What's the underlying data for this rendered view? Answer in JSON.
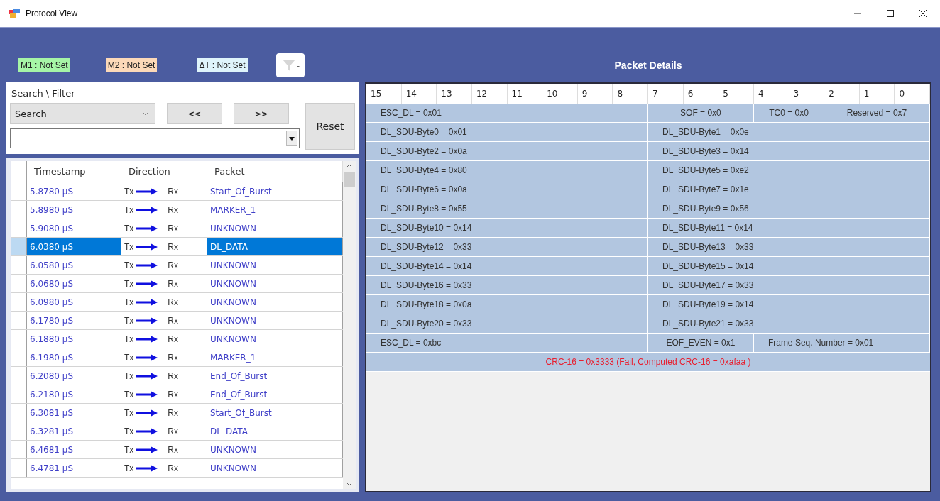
{
  "window": {
    "title": "Protocol View"
  },
  "markers": [
    {
      "label": "M1 : Not Set",
      "color": "#a6f5a6"
    },
    {
      "label": "M2 : Not Set",
      "color": "#fcd9b8"
    },
    {
      "label": "ΔT : Not Set",
      "color": "#dff4fb"
    }
  ],
  "search_filter": {
    "title": "Search \\ Filter",
    "mode": "Search",
    "prev": "<<",
    "next": ">>",
    "reset": "Reset"
  },
  "table": {
    "columns": [
      "Timestamp",
      "Direction",
      "Packet"
    ],
    "rows": [
      {
        "timestamp": "5.8780 µS",
        "from": "Tx",
        "to": "Rx",
        "packet": "Start_Of_Burst",
        "selected": false
      },
      {
        "timestamp": "5.8980 µS",
        "from": "Tx",
        "to": "Rx",
        "packet": "MARKER_1",
        "selected": false
      },
      {
        "timestamp": "5.9080 µS",
        "from": "Tx",
        "to": "Rx",
        "packet": "UNKNOWN",
        "selected": false
      },
      {
        "timestamp": "6.0380 µS",
        "from": "Tx",
        "to": "Rx",
        "packet": "DL_DATA",
        "selected": true
      },
      {
        "timestamp": "6.0580 µS",
        "from": "Tx",
        "to": "Rx",
        "packet": "UNKNOWN",
        "selected": false
      },
      {
        "timestamp": "6.0680 µS",
        "from": "Tx",
        "to": "Rx",
        "packet": "UNKNOWN",
        "selected": false
      },
      {
        "timestamp": "6.0980 µS",
        "from": "Tx",
        "to": "Rx",
        "packet": "UNKNOWN",
        "selected": false
      },
      {
        "timestamp": "6.1780 µS",
        "from": "Tx",
        "to": "Rx",
        "packet": "UNKNOWN",
        "selected": false
      },
      {
        "timestamp": "6.1880 µS",
        "from": "Tx",
        "to": "Rx",
        "packet": "UNKNOWN",
        "selected": false
      },
      {
        "timestamp": "6.1980 µS",
        "from": "Tx",
        "to": "Rx",
        "packet": "MARKER_1",
        "selected": false
      },
      {
        "timestamp": "6.2080 µS",
        "from": "Tx",
        "to": "Rx",
        "packet": "End_Of_Burst",
        "selected": false
      },
      {
        "timestamp": "6.2180 µS",
        "from": "Tx",
        "to": "Rx",
        "packet": "End_Of_Burst",
        "selected": false
      },
      {
        "timestamp": "6.3081 µS",
        "from": "Tx",
        "to": "Rx",
        "packet": "Start_Of_Burst",
        "selected": false
      },
      {
        "timestamp": "6.3281 µS",
        "from": "Tx",
        "to": "Rx",
        "packet": "DL_DATA",
        "selected": false
      },
      {
        "timestamp": "6.4681 µS",
        "from": "Tx",
        "to": "Rx",
        "packet": "UNKNOWN",
        "selected": false
      },
      {
        "timestamp": "6.4781 µS",
        "from": "Tx",
        "to": "Rx",
        "packet": "UNKNOWN",
        "selected": false
      }
    ]
  },
  "packet_details": {
    "title": "Packet Details",
    "bits": [
      "15",
      "14",
      "13",
      "12",
      "11",
      "10",
      "9",
      "8",
      "7",
      "6",
      "5",
      "4",
      "3",
      "2",
      "1",
      "0"
    ],
    "rows": [
      [
        {
          "text": "ESC_DL = 0x01",
          "kind": "byte"
        },
        {
          "text": "SOF = 0x0",
          "kind": "triple"
        },
        {
          "text": "TC0 = 0x0",
          "kind": "pair"
        },
        {
          "text": "Reserved = 0x7",
          "kind": "triple"
        }
      ],
      [
        {
          "text": "DL_SDU-Byte0 = 0x01",
          "kind": "byte"
        },
        {
          "text": "DL_SDU-Byte1 = 0x0e",
          "kind": "byte"
        }
      ],
      [
        {
          "text": "DL_SDU-Byte2 = 0x0a",
          "kind": "byte"
        },
        {
          "text": "DL_SDU-Byte3 = 0x14",
          "kind": "byte"
        }
      ],
      [
        {
          "text": "DL_SDU-Byte4 = 0x80",
          "kind": "byte"
        },
        {
          "text": "DL_SDU-Byte5 = 0xe2",
          "kind": "byte"
        }
      ],
      [
        {
          "text": "DL_SDU-Byte6 = 0x0a",
          "kind": "byte"
        },
        {
          "text": "DL_SDU-Byte7 = 0x1e",
          "kind": "byte"
        }
      ],
      [
        {
          "text": "DL_SDU-Byte8 = 0x55",
          "kind": "byte"
        },
        {
          "text": "DL_SDU-Byte9 = 0x56",
          "kind": "byte"
        }
      ],
      [
        {
          "text": "DL_SDU-Byte10 = 0x14",
          "kind": "byte"
        },
        {
          "text": "DL_SDU-Byte11 = 0x14",
          "kind": "byte"
        }
      ],
      [
        {
          "text": "DL_SDU-Byte12 = 0x33",
          "kind": "byte"
        },
        {
          "text": "DL_SDU-Byte13 = 0x33",
          "kind": "byte"
        }
      ],
      [
        {
          "text": "DL_SDU-Byte14 = 0x14",
          "kind": "byte"
        },
        {
          "text": "DL_SDU-Byte15 = 0x14",
          "kind": "byte"
        }
      ],
      [
        {
          "text": "DL_SDU-Byte16 = 0x33",
          "kind": "byte"
        },
        {
          "text": "DL_SDU-Byte17 = 0x33",
          "kind": "byte"
        }
      ],
      [
        {
          "text": "DL_SDU-Byte18 = 0x0a",
          "kind": "byte"
        },
        {
          "text": "DL_SDU-Byte19 = 0x14",
          "kind": "byte"
        }
      ],
      [
        {
          "text": "DL_SDU-Byte20 = 0x33",
          "kind": "byte"
        },
        {
          "text": "DL_SDU-Byte21 = 0x33",
          "kind": "byte"
        }
      ],
      [
        {
          "text": "ESC_DL = 0xbc",
          "kind": "byte"
        },
        {
          "text": "EOF_EVEN = 0x1",
          "kind": "triple"
        },
        {
          "text": "Frame Seq. Number = 0x01",
          "kind": "quint"
        }
      ]
    ],
    "crc_line": "CRC-16 = 0x3333 (Fail, Computed CRC-16 = 0xafaa )"
  }
}
